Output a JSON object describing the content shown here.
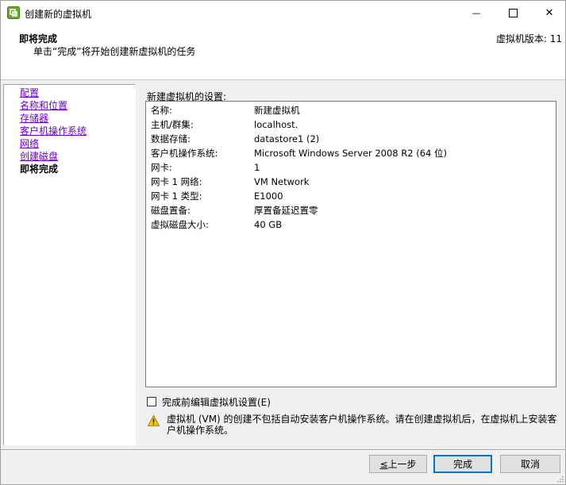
{
  "window": {
    "title": "创建新的虚拟机",
    "minimize_glyph": "—",
    "close_glyph": "✕"
  },
  "header": {
    "title": "即将完成",
    "subtitle": "单击“完成”将开始创建新虚拟机的任务",
    "version": "虚拟机版本: 11"
  },
  "nav": {
    "items": [
      {
        "label": "配置",
        "state": "link"
      },
      {
        "label": "名称和位置",
        "state": "link"
      },
      {
        "label": "存储器",
        "state": "link"
      },
      {
        "label": "客户机操作系统",
        "state": "link"
      },
      {
        "label": "网络",
        "state": "link"
      },
      {
        "label": "创建磁盘",
        "state": "link"
      },
      {
        "label": "即将完成",
        "state": "current"
      }
    ]
  },
  "settings": {
    "label": "新建虚拟机的设置:",
    "rows": [
      {
        "key": "名称:",
        "value": "新建虚拟机"
      },
      {
        "key": "主机/群集:",
        "value": "localhost."
      },
      {
        "key": "数据存储:",
        "value": "datastore1 (2)"
      },
      {
        "key": "客户机操作系统:",
        "value": "Microsoft Windows Server 2008 R2 (64 位)"
      },
      {
        "key": "网卡:",
        "value": "1"
      },
      {
        "key": "网卡 1 网络:",
        "value": "VM Network"
      },
      {
        "key": "网卡 1 类型:",
        "value": "E1000"
      },
      {
        "key": "磁盘置备:",
        "value": "厚置备延迟置零"
      },
      {
        "key": "虚拟磁盘大小:",
        "value": "40 GB"
      }
    ]
  },
  "edit_checkbox": {
    "label": "完成前编辑虚拟机设置(E)",
    "checked": false
  },
  "warning": {
    "text": "虚拟机 (VM) 的创建不包括自动安装客户机操作系统。请在创建虚拟机后，在虚拟机上安装客户机操作系统。"
  },
  "buttons": {
    "back_prefix": "≤",
    "back_label": "上一步",
    "finish_label": "完成",
    "cancel_label": "取消"
  },
  "colors": {
    "link": "#6a00d0",
    "focus_border": "#0078d7",
    "warning": "#f5c518"
  }
}
